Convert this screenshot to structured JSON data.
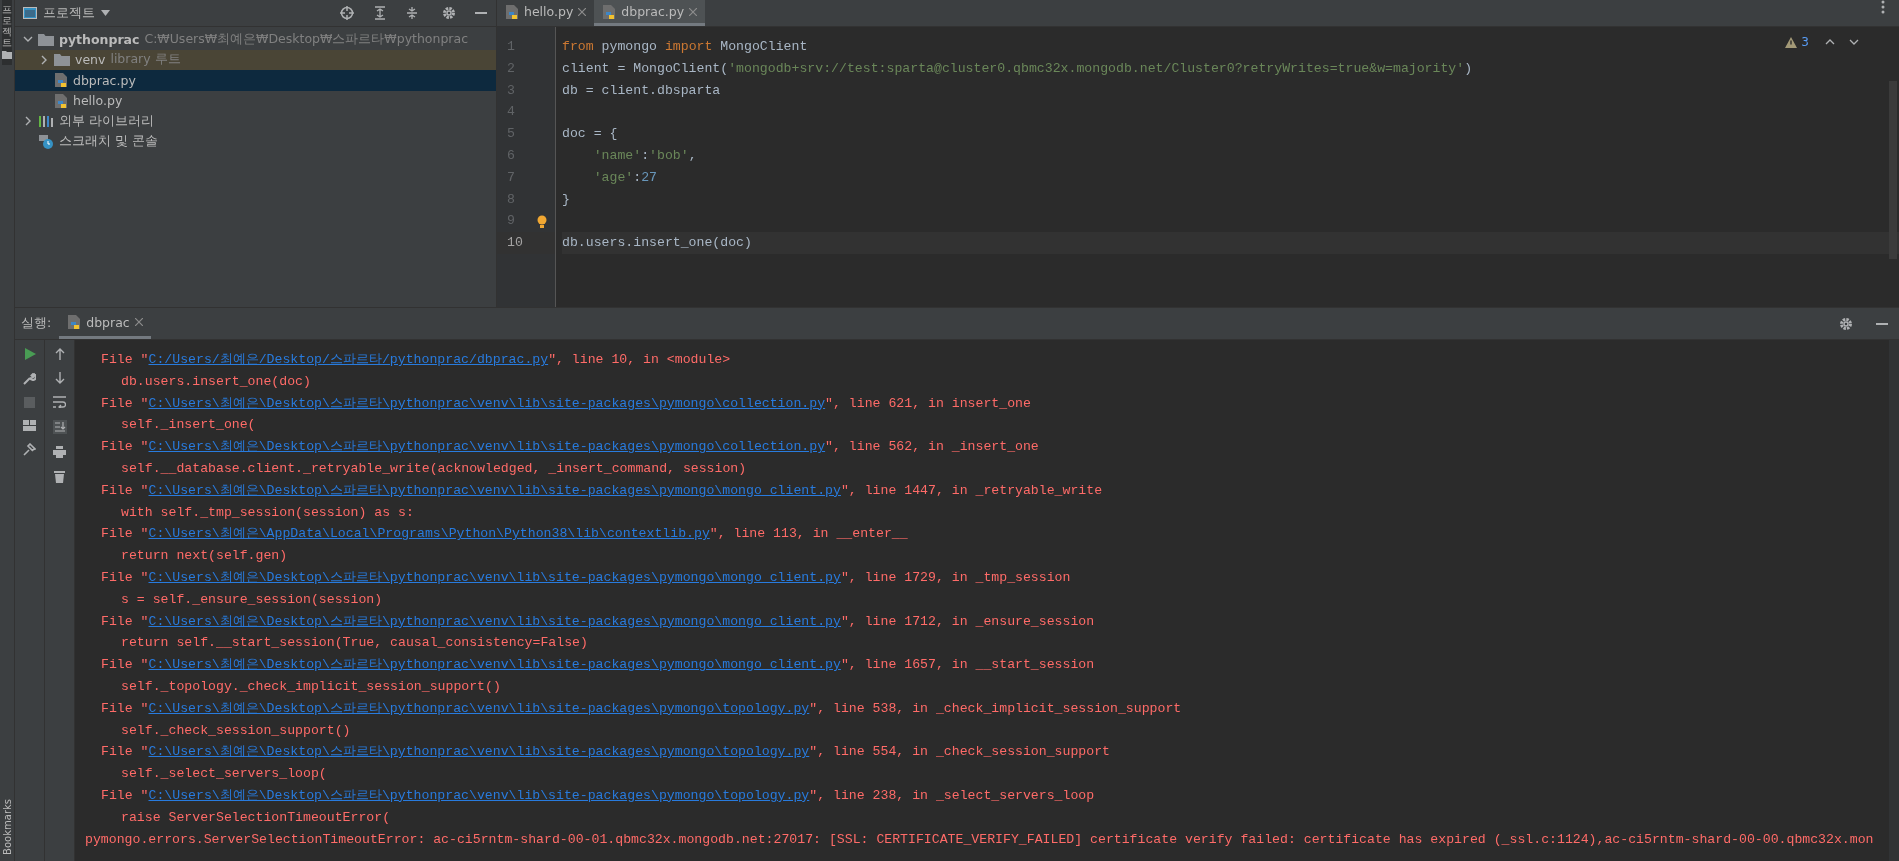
{
  "left_stripe": {
    "project_label": "프로젝트",
    "bookmarks_label": "Bookmarks"
  },
  "project_panel": {
    "title": "프로젝트",
    "tree": [
      {
        "name": "pythonprac",
        "hint": "C:₩Users₩최예은₩Desktop₩스파르타₩pythonprac",
        "kind": "folder",
        "expanded": true,
        "selected": false,
        "children": [
          {
            "name": "venv",
            "hint": "library 루트",
            "kind": "library-folder",
            "expanded": false,
            "selected": false
          },
          {
            "name": "dbprac.py",
            "kind": "python-file",
            "selected": true
          },
          {
            "name": "hello.py",
            "kind": "python-file",
            "selected": false
          }
        ]
      },
      {
        "name": "외부 라이브러리",
        "kind": "libraries",
        "expanded": false,
        "selected": false
      },
      {
        "name": "스크래치 및 콘솔",
        "kind": "scratches",
        "selected": false
      }
    ]
  },
  "editor": {
    "tabs": [
      {
        "label": "hello.py",
        "selected": false
      },
      {
        "label": "dbprac.py",
        "selected": true
      }
    ],
    "warning_count": "3",
    "lines": [
      {
        "number": "1",
        "current": false,
        "bulb": false,
        "tokens": [
          {
            "kind": "keyword",
            "text": "from"
          },
          {
            "kind": "plain",
            "text": " pymongo "
          },
          {
            "kind": "keyword",
            "text": "import"
          },
          {
            "kind": "plain",
            "text": " MongoClient"
          }
        ]
      },
      {
        "number": "2",
        "current": false,
        "bulb": false,
        "tokens": [
          {
            "kind": "plain",
            "text": "client = MongoClient("
          },
          {
            "kind": "string",
            "text": "'mongodb+srv://test:sparta@cluster0.qbmc32x.mongodb.net/Cluster0?retryWrites=true&w=majority'"
          },
          {
            "kind": "plain",
            "text": ")"
          }
        ]
      },
      {
        "number": "3",
        "current": false,
        "bulb": false,
        "tokens": [
          {
            "kind": "plain",
            "text": "db = client.dbsparta"
          }
        ]
      },
      {
        "number": "4",
        "current": false,
        "bulb": false
      },
      {
        "number": "5",
        "current": false,
        "bulb": false,
        "tokens": [
          {
            "kind": "plain",
            "text": "doc = {"
          }
        ]
      },
      {
        "number": "6",
        "current": false,
        "bulb": false,
        "tokens": [
          {
            "kind": "string",
            "text": "    'name'"
          },
          {
            "kind": "plain",
            "text": ":"
          },
          {
            "kind": "string",
            "text": "'bob'"
          },
          {
            "kind": "plain",
            "text": ","
          }
        ]
      },
      {
        "number": "7",
        "current": false,
        "bulb": false,
        "tokens": [
          {
            "kind": "string",
            "text": "    'age'"
          },
          {
            "kind": "plain",
            "text": ":"
          },
          {
            "kind": "number",
            "text": "27"
          }
        ]
      },
      {
        "number": "8",
        "current": false,
        "bulb": false,
        "tokens": [
          {
            "kind": "plain",
            "text": "}"
          }
        ]
      },
      {
        "number": "9",
        "current": false,
        "bulb": true
      },
      {
        "number": "10",
        "current": true,
        "bulb": false,
        "tokens": [
          {
            "kind": "plain",
            "text": "db.users.insert_one(doc)"
          }
        ]
      }
    ]
  },
  "run_panel": {
    "label": "실행:",
    "tab": "dbprac",
    "console": [
      {
        "kind": "file",
        "prefix": "File \"",
        "link": "C:/Users/최예은/Desktop/스파르타/pythonprac/dbprac.py",
        "suffix": "\", line 10, in <module>"
      },
      {
        "kind": "code",
        "text": "db.users.insert_one(doc)"
      },
      {
        "kind": "file",
        "prefix": "File \"",
        "link": "C:\\Users\\최예은\\Desktop\\스파르타\\pythonprac\\venv\\lib\\site-packages\\pymongo\\collection.py",
        "suffix": "\", line 621, in insert_one"
      },
      {
        "kind": "code",
        "text": "self._insert_one("
      },
      {
        "kind": "file",
        "prefix": "File \"",
        "link": "C:\\Users\\최예은\\Desktop\\스파르타\\pythonprac\\venv\\lib\\site-packages\\pymongo\\collection.py",
        "suffix": "\", line 562, in _insert_one"
      },
      {
        "kind": "code",
        "text": "self.__database.client._retryable_write(acknowledged, _insert_command, session)"
      },
      {
        "kind": "file",
        "prefix": "File \"",
        "link": "C:\\Users\\최예은\\Desktop\\스파르타\\pythonprac\\venv\\lib\\site-packages\\pymongo\\mongo_client.py",
        "suffix": "\", line 1447, in _retryable_write"
      },
      {
        "kind": "code",
        "text": "with self._tmp_session(session) as s:"
      },
      {
        "kind": "file",
        "prefix": "File \"",
        "link": "C:\\Users\\최예은\\AppData\\Local\\Programs\\Python\\Python38\\lib\\contextlib.py",
        "suffix": "\", line 113, in __enter__"
      },
      {
        "kind": "code",
        "text": "return next(self.gen)"
      },
      {
        "kind": "file",
        "prefix": "File \"",
        "link": "C:\\Users\\최예은\\Desktop\\스파르타\\pythonprac\\venv\\lib\\site-packages\\pymongo\\mongo_client.py",
        "suffix": "\", line 1729, in _tmp_session"
      },
      {
        "kind": "code",
        "text": "s = self._ensure_session(session)"
      },
      {
        "kind": "file",
        "prefix": "File \"",
        "link": "C:\\Users\\최예은\\Desktop\\스파르타\\pythonprac\\venv\\lib\\site-packages\\pymongo\\mongo_client.py",
        "suffix": "\", line 1712, in _ensure_session"
      },
      {
        "kind": "code",
        "text": "return self.__start_session(True, causal_consistency=False)"
      },
      {
        "kind": "file",
        "prefix": "File \"",
        "link": "C:\\Users\\최예은\\Desktop\\스파르타\\pythonprac\\venv\\lib\\site-packages\\pymongo\\mongo_client.py",
        "suffix": "\", line 1657, in __start_session"
      },
      {
        "kind": "code",
        "text": "self._topology._check_implicit_session_support()"
      },
      {
        "kind": "file",
        "prefix": "File \"",
        "link": "C:\\Users\\최예은\\Desktop\\스파르타\\pythonprac\\venv\\lib\\site-packages\\pymongo\\topology.py",
        "suffix": "\", line 538, in _check_implicit_session_support"
      },
      {
        "kind": "code",
        "text": "self._check_session_support()"
      },
      {
        "kind": "file",
        "prefix": "File \"",
        "link": "C:\\Users\\최예은\\Desktop\\스파르타\\pythonprac\\venv\\lib\\site-packages\\pymongo\\topology.py",
        "suffix": "\", line 554, in _check_session_support"
      },
      {
        "kind": "code",
        "text": "self._select_servers_loop("
      },
      {
        "kind": "file",
        "prefix": "File \"",
        "link": "C:\\Users\\최예은\\Desktop\\스파르타\\pythonprac\\venv\\lib\\site-packages\\pymongo\\topology.py",
        "suffix": "\", line 238, in _select_servers_loop"
      },
      {
        "kind": "code",
        "text": "raise ServerSelectionTimeoutError("
      },
      {
        "kind": "message",
        "text": "pymongo.errors.ServerSelectionTimeoutError: ac-ci5rntm-shard-00-01.qbmc32x.mongodb.net:27017: [SSL: CERTIFICATE_VERIFY_FAILED] certificate verify failed: certificate has expired (_ssl.c:1124),ac-ci5rntm-shard-00-00.qbmc32x.mon"
      }
    ]
  }
}
